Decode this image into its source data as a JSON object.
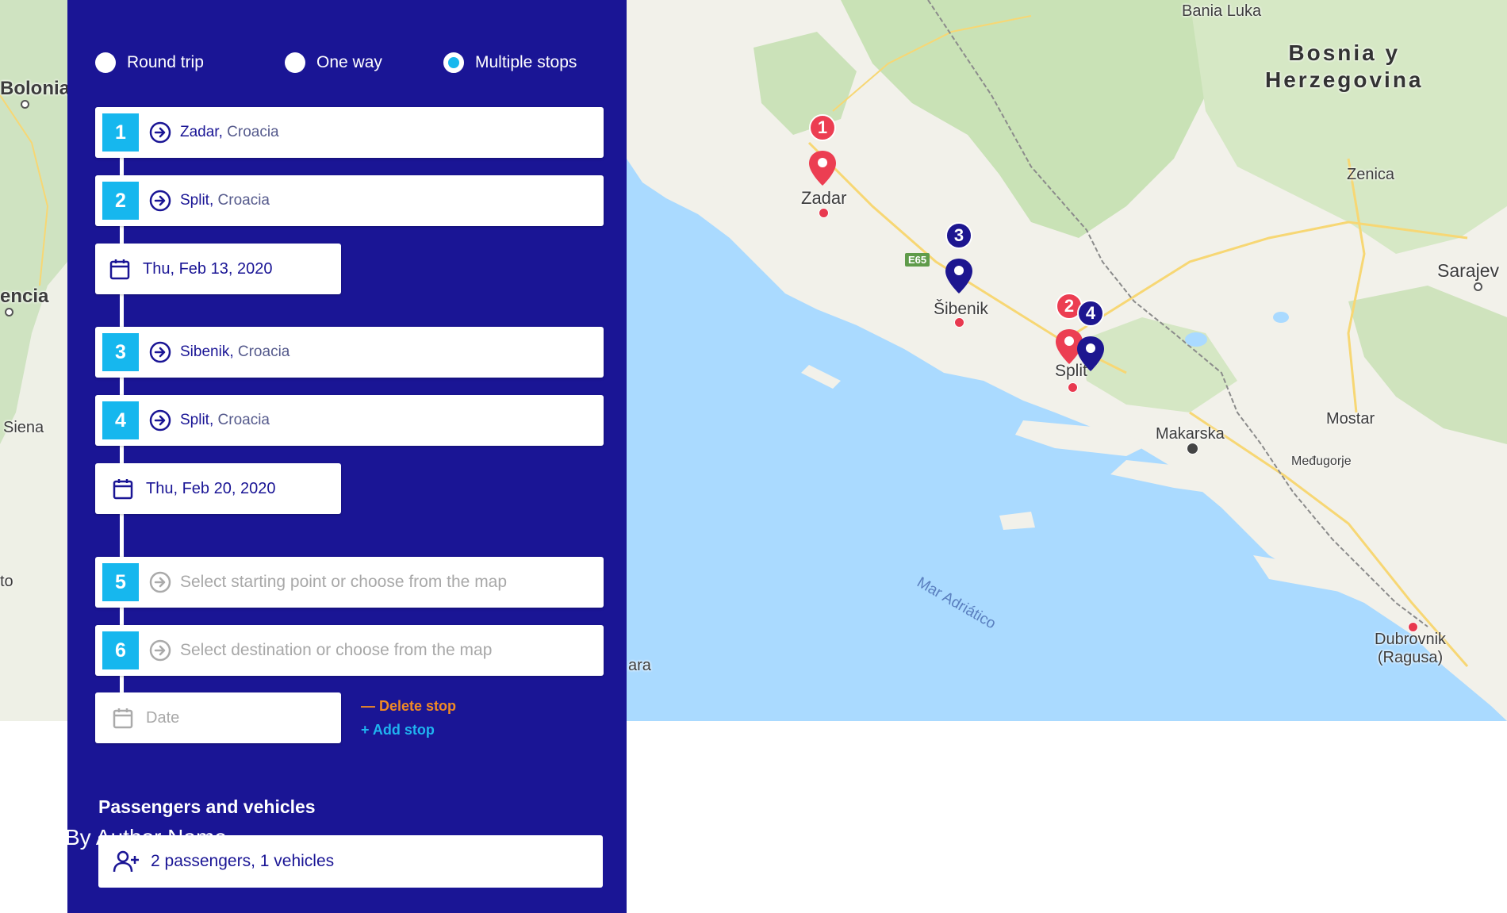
{
  "map": {
    "labels": {
      "bolonia": "Bolonia",
      "encia": "encia",
      "siena": "Siena",
      "to": "to",
      "ara": "ara",
      "bania_luka": "Bania Luka",
      "bosnia": "Bosnia y\nHerzegovina",
      "zenica": "Zenica",
      "sarajevo": "Sarajev",
      "zadar": "Zadar",
      "sibenik": "Šibenik",
      "split": "Split",
      "makarska": "Makarska",
      "mostar": "Mostar",
      "medugorje": "Međugorje",
      "dubrovnik": "Dubrovnik\n(Ragusa)",
      "sea": "Mar Adriático",
      "road": "E65"
    },
    "markers": [
      {
        "number": "1",
        "color": "#ec3e52"
      },
      {
        "number": "2",
        "color": "#ec3e52"
      },
      {
        "number": "3",
        "color": "#1d1690"
      },
      {
        "number": "4",
        "color": "#1d1690"
      }
    ]
  },
  "panel": {
    "trip_types": [
      {
        "label": "Round trip",
        "selected": false
      },
      {
        "label": "One way",
        "selected": false
      },
      {
        "label": "Multiple stops",
        "selected": true
      }
    ],
    "stops": [
      {
        "number": "1",
        "city": "Zadar,",
        "country": " Croacia"
      },
      {
        "number": "2",
        "city": "Split,",
        "country": " Croacia"
      },
      {
        "number": "3",
        "city": "Sibenik,",
        "country": " Croacia"
      },
      {
        "number": "4",
        "city": "Split,",
        "country": " Croacia"
      },
      {
        "number": "5",
        "placeholder": "Select starting point or choose from the map"
      },
      {
        "number": "6",
        "placeholder": "Select destination or choose from the map"
      }
    ],
    "dates": [
      {
        "value": "Thu, Feb 13, 2020"
      },
      {
        "value": "Thu, Feb 20, 2020"
      },
      {
        "placeholder": "Date"
      }
    ],
    "delete_stop": "— Delete stop",
    "add_stop": "+ Add stop",
    "passengers_title": "Passengers and vehicles",
    "passengers_value": "2 passengers, 1 vehicles"
  },
  "author": "By Author Name",
  "colors": {
    "panel": "#1a1595",
    "accent": "#16b7ee",
    "marker_red": "#ec3e52",
    "marker_blue": "#1d1690",
    "delete": "#f08a24",
    "add": "#1fb4f0",
    "sea": "#aadaff"
  }
}
